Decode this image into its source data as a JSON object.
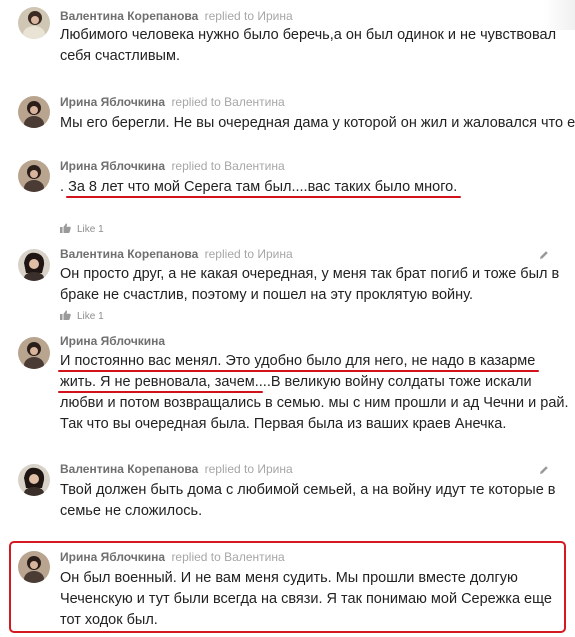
{
  "labels": {
    "replied_to": "replied to",
    "like_text": "Like 1"
  },
  "comments": [
    {
      "author": "Валентина Корепанова",
      "reply_to": "Ирина",
      "lines": [
        "Любимого человека нужно было беречь,а он был одинок и не чувствовал",
        "себя счастливым."
      ]
    },
    {
      "author": "Ирина Яблочкина",
      "reply_to": "Валентина",
      "lines": [
        "Мы его берегли. Не вы очередная дама у которой он жил и жаловался что е"
      ]
    },
    {
      "author": "Ирина Яблочкина",
      "reply_to": "Валентина",
      "prefix": ". ",
      "underlined": "За 8 лет что мой Серега там был....вас таких было много."
    },
    {
      "author": "Валентина Корепанова",
      "reply_to": "Ирина",
      "lines": [
        "Он просто друг, а не какая очередная, у меня так брат погиб и тоже был в",
        "браке не счастлив, поэтому и пошел на эту проклятую войну."
      ]
    },
    {
      "author": "Ирина Яблочкина",
      "line1": "И постоянно вас менял. Это удобно было для него, не надо в казарме",
      "line2_underlined": "жить. Я не ревновала, зачем.",
      "line2_rest": "...В великую войну солдаты тоже искали",
      "line3": "любви и потом возвращались в семью. мы с ним прошли и ад Чечни и рай.",
      "line4": "Так что вы очередная была. Первая была из ваших краев Анечка."
    },
    {
      "author": "Валентина Корепанова",
      "reply_to": "Ирина",
      "lines": [
        "Твой должен быть дома  с любимой семьей, а на войну идут те которые в",
        "семье не сложилось."
      ]
    },
    {
      "author": "Ирина Яблочкина",
      "reply_to": "Валентина",
      "lines": [
        "Он был военный. И не вам меня судить. Мы прошли вместе долгую",
        "Чеченскую и тут были всегда на связи. Я так понимаю мой Сережка еще",
        "тот ходок был."
      ]
    }
  ],
  "colors": {
    "highlight_red": "#d41920",
    "author_gray": "#6f6f6f",
    "meta_gray": "#a6a6a6"
  }
}
